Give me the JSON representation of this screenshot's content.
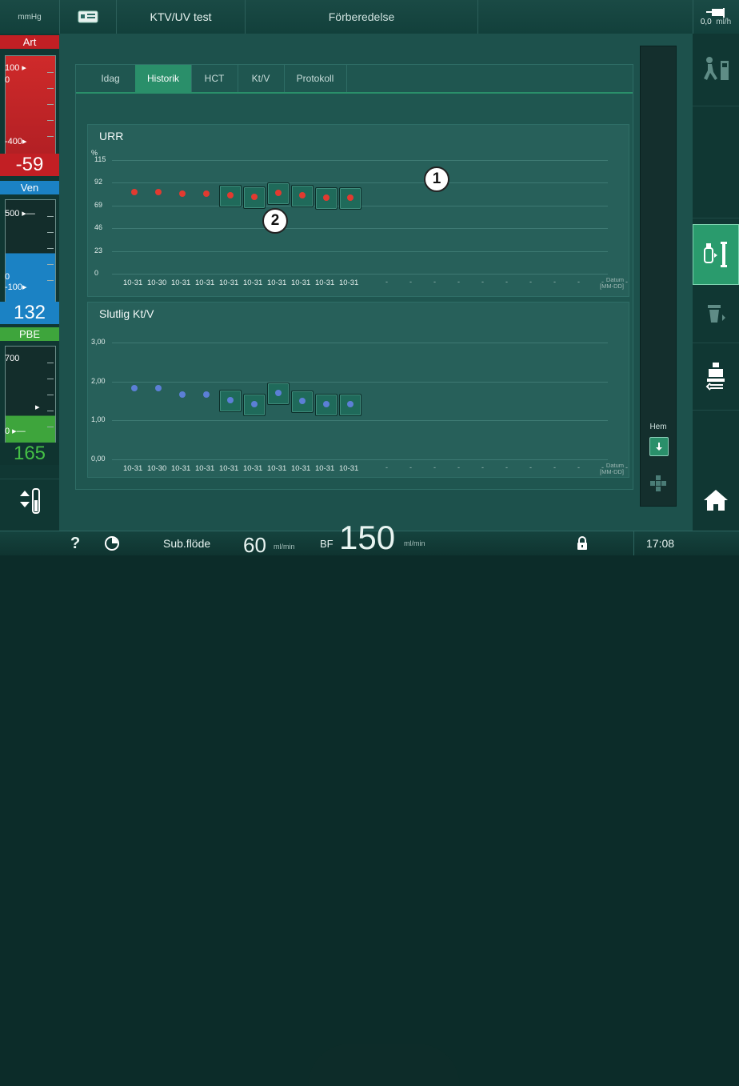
{
  "topbar": {
    "unit": "mmHg",
    "patient": "KTV/UV test",
    "phase": "Förberedelse",
    "uf_value": "0,0",
    "uf_unit": "ml/h"
  },
  "left": {
    "art": {
      "label": "Art",
      "top": "100",
      "sub": "0",
      "low": "-400",
      "value": "-59"
    },
    "ven": {
      "label": "Ven",
      "top": "500",
      "zero": "0",
      "low": "-100",
      "value": "132"
    },
    "pbe": {
      "label": "PBE",
      "top": "700",
      "zero": "0",
      "value": "165"
    }
  },
  "tabs": [
    "Idag",
    "Historik",
    "HCT",
    "Kt/V",
    "Protokoll"
  ],
  "active_tab": "Historik",
  "chart_data": [
    {
      "type": "scatter",
      "title": "URR",
      "ylabel": "%",
      "yticks": [
        "115",
        "92",
        "69",
        "46",
        "23",
        "0"
      ],
      "ylim": [
        0,
        115
      ],
      "xlabel": "Datum [MM-DD]",
      "categories": [
        "10-31",
        "10-30",
        "10-31",
        "10-31",
        "10-31",
        "10-31",
        "10-31",
        "10-31",
        "10-31",
        "10-31"
      ],
      "values": [
        83,
        83,
        81,
        81,
        79,
        78,
        82,
        79,
        77,
        77
      ],
      "highlighted": [
        false,
        false,
        false,
        false,
        true,
        true,
        true,
        true,
        true,
        true
      ]
    },
    {
      "type": "scatter",
      "title": "Slutlig Kt/V",
      "yticks": [
        "3,00",
        "2,00",
        "1,00",
        "0,00"
      ],
      "ylim": [
        0,
        3
      ],
      "xlabel": "Datum [MM-DD]",
      "categories": [
        "10-31",
        "10-30",
        "10-31",
        "10-31",
        "10-31",
        "10-31",
        "10-31",
        "10-31",
        "10-31",
        "10-31"
      ],
      "values": [
        1.82,
        1.82,
        1.66,
        1.66,
        1.52,
        1.42,
        1.7,
        1.5,
        1.42,
        1.42
      ],
      "highlighted": [
        false,
        false,
        false,
        false,
        true,
        true,
        true,
        true,
        true,
        true
      ]
    }
  ],
  "chart_common": {
    "dashes": "-",
    "datum_line1": "Datum",
    "datum_line2": "[MM-DD]"
  },
  "callouts": {
    "c1": "1",
    "c2": "2"
  },
  "scroll": {
    "hem_label": "Hem"
  },
  "bottombar": {
    "help": "?",
    "sub_label": "Sub.flöde",
    "sub_value": "60",
    "sub_unit": "ml/min",
    "bf_label": "BF",
    "bf_value": "150",
    "bf_unit": "ml/min",
    "time": "17:08"
  },
  "colors": {
    "red": "#c21f24",
    "blue": "#1b82c4",
    "green": "#3ea53c",
    "accent": "#2a8f6a",
    "dot_red": "#e23a30",
    "dot_blue": "#5c7fd6"
  },
  "icons": [
    "card-icon",
    "walk-out-icon",
    "connect-patient-icon",
    "filter-icon",
    "tubing-icon",
    "home-icon",
    "arrow-down-icon",
    "lock-icon",
    "clock-icon",
    "help-icon",
    "level-icon"
  ]
}
